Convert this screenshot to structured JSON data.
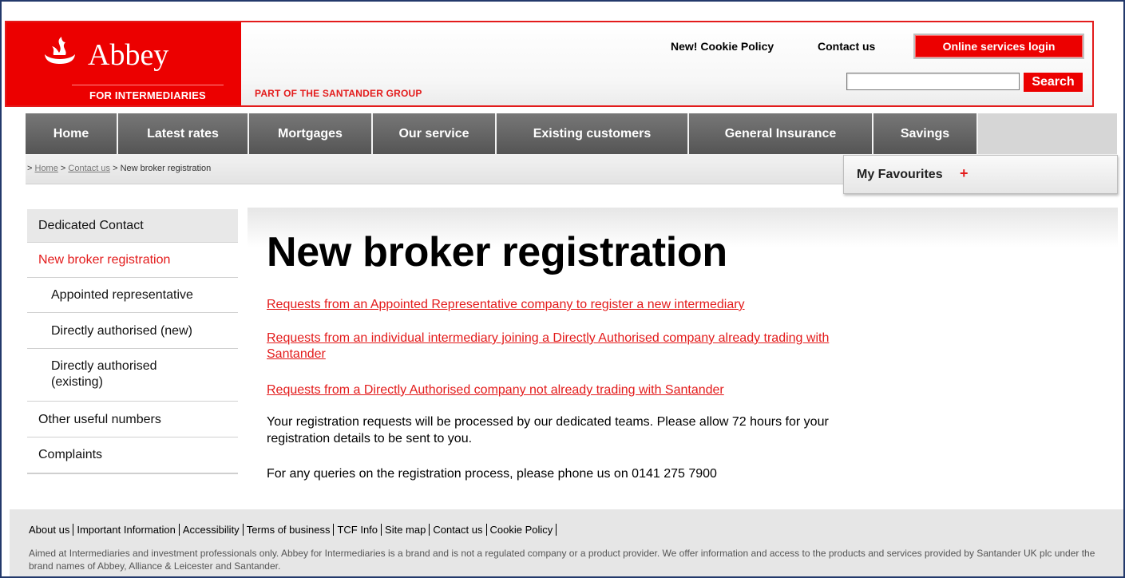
{
  "header": {
    "brand": "Abbey",
    "sub_brand": "FOR INTERMEDIARIES",
    "group_text": "PART OF THE SANTANDER GROUP",
    "links": [
      "New! Cookie Policy",
      "Contact us"
    ],
    "login_label": "Online services login",
    "search_value": "",
    "search_label": "Search",
    "colors": {
      "brand_red": "#ec0000",
      "nav_grey": "#666666"
    }
  },
  "nav": {
    "items": [
      "Home",
      "Latest rates",
      "Mortgages",
      "Our service",
      "Existing customers",
      "General Insurance",
      "Savings"
    ]
  },
  "breadcrumb": {
    "prefix": ">",
    "home": "Home",
    "sep": ">",
    "contact": "Contact us",
    "current": "New broker registration"
  },
  "favourites": {
    "label": "My Favourites",
    "plus": "+"
  },
  "sidebar": {
    "items": [
      "Dedicated Contact",
      "New broker registration",
      "Appointed representative",
      "Directly authorised (new)",
      "Directly authorised (existing)",
      "Other useful numbers",
      "Complaints"
    ]
  },
  "main": {
    "title": "New broker registration",
    "links": [
      "Requests from an Appointed Representative company to register a new intermediary",
      "Requests from an individual intermediary joining a Directly Authorised company already trading with Santander",
      "Requests from a Directly Authorised company not already trading with Santander"
    ],
    "paragraphs": [
      "Your registration requests will be processed by our dedicated teams. Please allow 72 hours for your registration details to be sent to you.",
      "For any queries on the registration process, please phone us on 0141 275 7900"
    ]
  },
  "footer": {
    "links": [
      "About us",
      "Important Information",
      "Accessibility",
      "Terms of business",
      "TCF Info",
      "Site map",
      "Contact us",
      "Cookie Policy"
    ],
    "note": "Aimed at Intermediaries and investment professionals only. Abbey for Intermediaries is a brand and is not a regulated company or a product provider. We offer information and access to the products and services provided by Santander UK plc under the brand names of Abbey, Alliance & Leicester and Santander."
  }
}
